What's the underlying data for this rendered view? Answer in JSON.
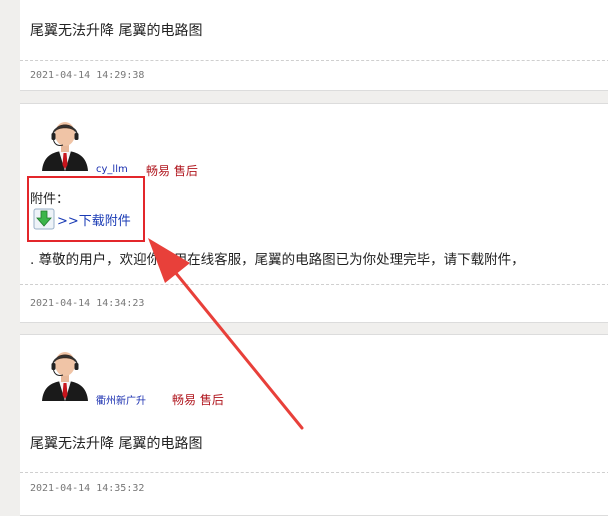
{
  "posts": [
    {
      "message": "尾翼无法升降 尾翼的电路图",
      "timestamp": "2021-04-14 14:29:38"
    },
    {
      "username": "cy_llm",
      "role": "畅易 售后",
      "attachment_label": "附件：",
      "download_link": ">>下载附件",
      "message": ". 尊敬的用户，欢迎你使用在线客服，尾翼的电路图已为你处理完毕，请下载附件，",
      "timestamp": "2021-04-14 14:34:23"
    },
    {
      "username": "衢州新广升",
      "role": "畅易 售后",
      "message": "尾翼无法升降 尾翼的电路图",
      "timestamp": "2021-04-14 14:35:32"
    }
  ],
  "colors": {
    "highlight": "#e3262b",
    "link": "#1a3bb5",
    "role": "#b0171f",
    "username": "#1a2fb0"
  },
  "icons": {
    "avatar": "support-agent-avatar-icon",
    "download": "green-download-arrow-icon"
  }
}
